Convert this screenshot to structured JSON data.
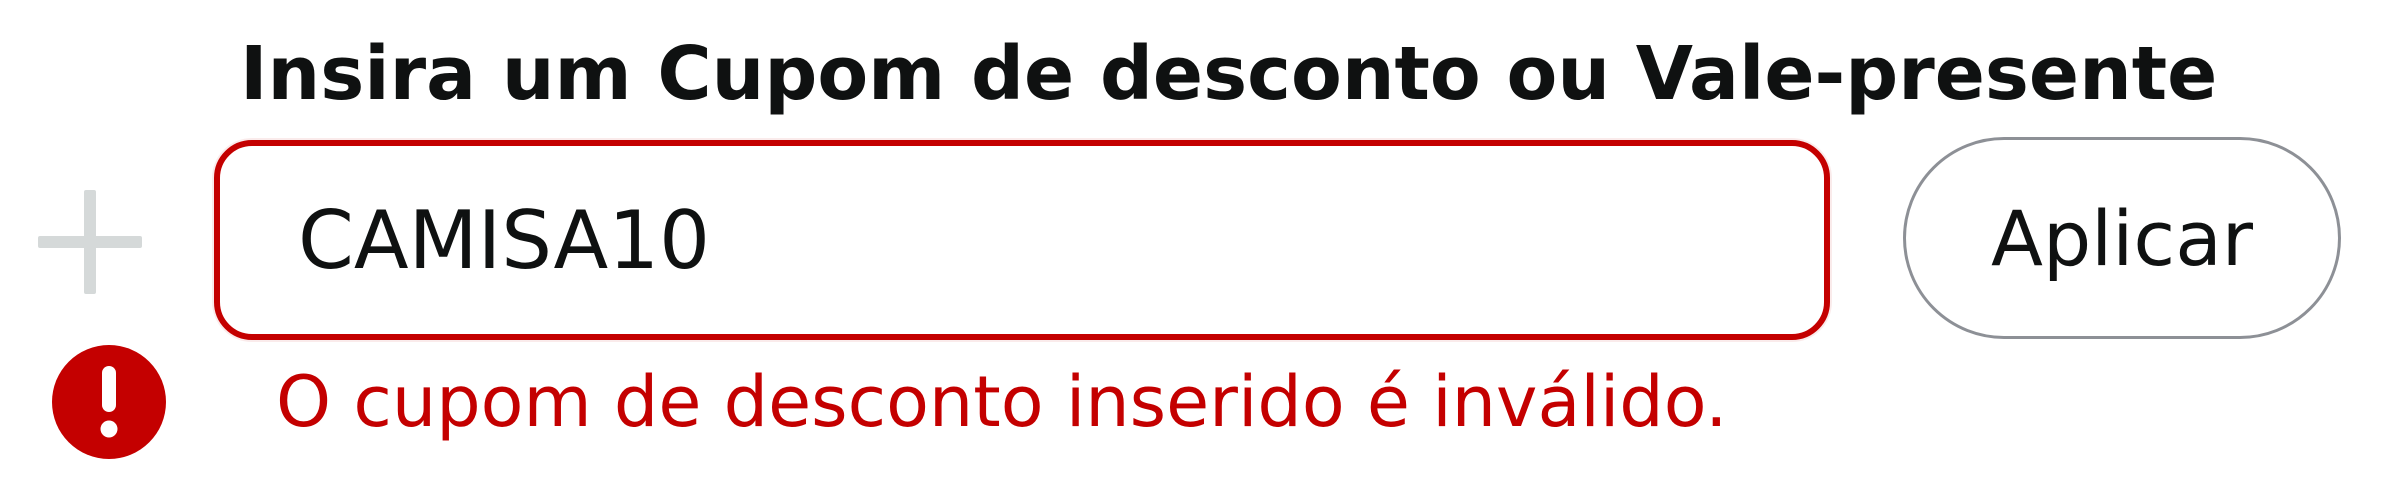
{
  "coupon_section": {
    "title": "Insira um Cupom de desconto ou Vale-presente",
    "input_value": "CAMISA10",
    "apply_label": "Aplicar",
    "error_message": "O cupom de desconto inserido é inválido.",
    "icons": {
      "expand": "plus-icon",
      "error": "exclamation-circle-icon"
    },
    "colors": {
      "error": "#c40000",
      "expand_icon": "#d5d9d9",
      "button_border": "#8d9096",
      "text": "#0f1111"
    }
  }
}
